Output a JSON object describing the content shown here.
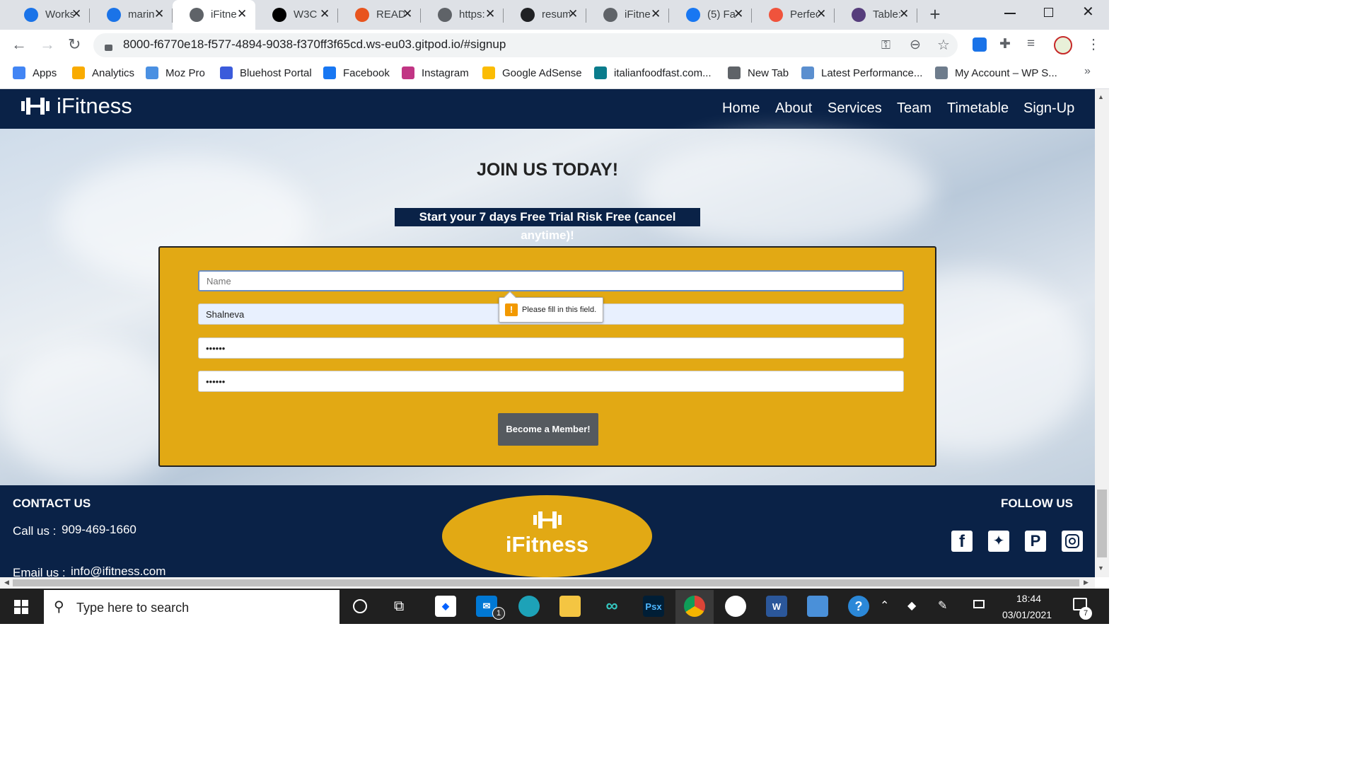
{
  "browser": {
    "tabs": [
      {
        "label": "Works",
        "icon_color": "#1a73e8",
        "icon": "gitpod-icon"
      },
      {
        "label": "marin",
        "icon_color": "#1a73e8",
        "icon": "gitpod-icon"
      },
      {
        "label": "iFitne",
        "icon_color": "#5f6368",
        "icon": "globe-icon",
        "active": true
      },
      {
        "label": "W3C",
        "icon_color": "#000000",
        "icon": "w3c-icon"
      },
      {
        "label": "READ",
        "icon_color": "#e8541e",
        "icon": "readme-icon"
      },
      {
        "label": "https:",
        "icon_color": "#5f6368",
        "icon": "globe-icon"
      },
      {
        "label": "resum",
        "icon_color": "#202124",
        "icon": "github-icon"
      },
      {
        "label": "iFitne",
        "icon_color": "#5f6368",
        "icon": "globe-icon"
      },
      {
        "label": "(5) Fa",
        "icon_color": "#1877f2",
        "icon": "facebook-icon"
      },
      {
        "label": "Perfec",
        "icon_color": "#f0533c",
        "icon": "perfecto-icon"
      },
      {
        "label": "Table:",
        "icon_color": "#563d7c",
        "icon": "bootstrap-icon"
      }
    ],
    "url": "8000-f6770e18-f577-4894-9038-f370ff3f65cd.ws-eu03.gitpod.io/#signup",
    "bookmarks": [
      {
        "label": "Apps",
        "icon": "apps-grid-icon",
        "color": "#4285f4"
      },
      {
        "label": "Analytics",
        "icon": "analytics-icon",
        "color": "#f9ab00"
      },
      {
        "label": "Moz Pro",
        "icon": "moz-icon",
        "color": "#4a90e2"
      },
      {
        "label": "Bluehost Portal",
        "icon": "bluehost-icon",
        "color": "#3b5bdb"
      },
      {
        "label": "Facebook",
        "icon": "facebook-icon",
        "color": "#1877f2"
      },
      {
        "label": "Instagram",
        "icon": "instagram-icon",
        "color": "#c13584"
      },
      {
        "label": "Google AdSense",
        "icon": "adsense-icon",
        "color": "#fbbc04"
      },
      {
        "label": "italianfoodfast.com...",
        "icon": "check-icon",
        "color": "#0a7c8c"
      },
      {
        "label": "New Tab",
        "icon": "globe-icon",
        "color": "#5f6368"
      },
      {
        "label": "Latest Performance...",
        "icon": "gtmetrix-icon",
        "color": "#5b8fcf"
      },
      {
        "label": "My Account – WP S...",
        "icon": "wordpress-icon",
        "color": "#6e7c8c"
      }
    ],
    "more_bookmarks": "»"
  },
  "site": {
    "brand": "iFitness",
    "nav": [
      "Home",
      "About",
      "Services",
      "Team",
      "Timetable",
      "Sign-Up"
    ],
    "heading": "JOIN US TODAY!",
    "subheading": "Start your 7 days Free Trial Risk Free (cancel anytime)!",
    "form": {
      "name_placeholder": "Name",
      "surname_value": "Shalneva",
      "password_value": "••••••",
      "confirm_value": "••••••",
      "submit_label": "Become a Member!",
      "validation_message": "Please fill in this field.",
      "validation_icon": "!"
    },
    "footer": {
      "contact_title": "CONTACT US",
      "call_label": "Call us :",
      "phone": "909-469-1660",
      "email_label": "Email us :",
      "email": "info@ifitness.com",
      "logo_text": "iFitness",
      "follow_title": "FOLLOW US",
      "social": [
        "facebook-icon",
        "twitter-icon",
        "pinterest-icon",
        "instagram-icon"
      ]
    },
    "colors": {
      "navy": "#0a2247",
      "gold": "#e2a914",
      "button": "#555a5f"
    }
  },
  "taskbar": {
    "search_placeholder": "Type here to search",
    "time": "18:44",
    "date": "03/01/2021",
    "notifications": "7",
    "mail_badge": "1",
    "word_label": "W",
    "psx_label": "Psx"
  }
}
